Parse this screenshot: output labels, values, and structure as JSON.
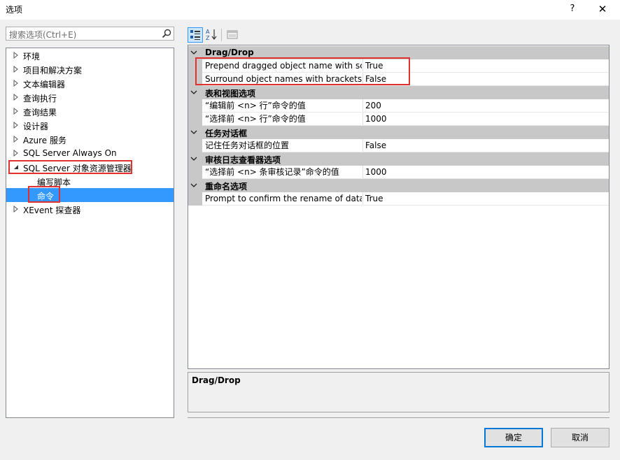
{
  "window": {
    "title": "选项",
    "help": "?",
    "close": "✕"
  },
  "search": {
    "placeholder": "搜索选项(Ctrl+E)"
  },
  "tree": {
    "items": [
      {
        "label": "环境",
        "expanded": false
      },
      {
        "label": "项目和解决方案",
        "expanded": false
      },
      {
        "label": "文本编辑器",
        "expanded": false
      },
      {
        "label": "查询执行",
        "expanded": false
      },
      {
        "label": "查询结果",
        "expanded": false
      },
      {
        "label": "设计器",
        "expanded": false
      },
      {
        "label": "Azure 服务",
        "expanded": false
      },
      {
        "label": "SQL Server Always On",
        "expanded": false
      },
      {
        "label": "SQL Server 对象资源管理器",
        "expanded": true
      },
      {
        "label": "编写脚本"
      },
      {
        "label": "命令",
        "selected": true
      },
      {
        "label": "XEvent 探查器",
        "expanded": false
      }
    ]
  },
  "grid": {
    "categories": [
      {
        "label": "Drag/Drop",
        "rows": [
          {
            "name": "Prepend dragged object name with schema",
            "value": "True"
          },
          {
            "name": "Surround object names with brackets when dragged",
            "value": "False"
          }
        ]
      },
      {
        "label": "表和视图选项",
        "rows": [
          {
            "name": "“编辑前 <n> 行”命令的值",
            "value": "200"
          },
          {
            "name": "“选择前 <n> 行”命令的值",
            "value": "1000"
          }
        ]
      },
      {
        "label": "任务对话框",
        "rows": [
          {
            "name": "记住任务对话框的位置",
            "value": "False"
          }
        ]
      },
      {
        "label": "审核日志查看器选项",
        "rows": [
          {
            "name": "“选择前 <n> 条审核记录”命令的值",
            "value": "1000"
          }
        ]
      },
      {
        "label": "重命名选项",
        "rows": [
          {
            "name": "Prompt to confirm the rename of database objects",
            "value": "True"
          }
        ]
      }
    ]
  },
  "description": {
    "title": "Drag/Drop"
  },
  "buttons": {
    "ok": "确定",
    "cancel": "取消"
  },
  "colors": {
    "selection": "#3399ff",
    "highlight_box": "#e0302f",
    "category_bg": "#c8c8c8",
    "default_button_border": "#0078d7"
  }
}
